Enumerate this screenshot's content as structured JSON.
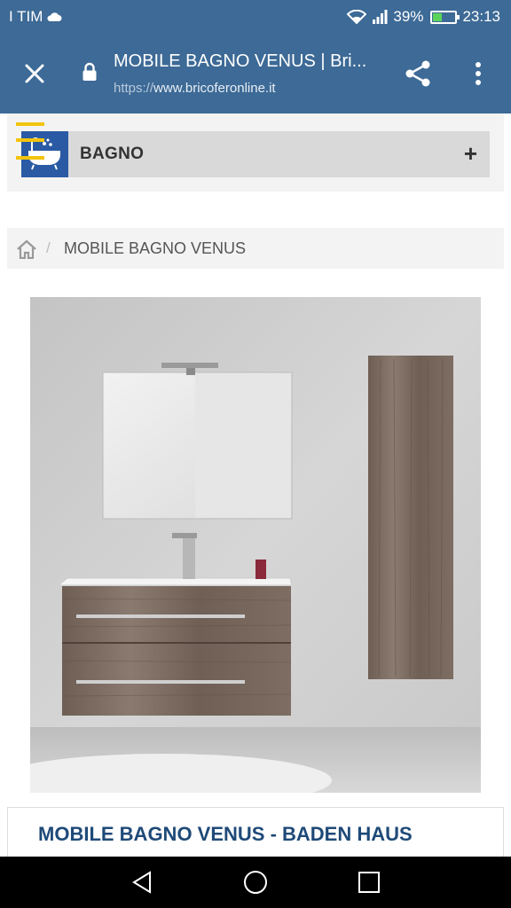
{
  "status_bar": {
    "carrier": "I TIM",
    "battery": "39%",
    "time": "23:13",
    "icons": [
      "cloud-icon",
      "wifi-icon",
      "signal-icon",
      "battery-icon"
    ]
  },
  "browser": {
    "title": "MOBILE BAGNO VENUS | Bri...",
    "url_scheme": "https://",
    "url_host": "www.bricoferonline.it",
    "icons": [
      "close-icon",
      "lock-icon",
      "share-icon",
      "more-vert-icon"
    ]
  },
  "category": {
    "label": "BAGNO",
    "expand_symbol": "+",
    "icon": "bathtub-icon",
    "accent_color": "#2b5aa5",
    "stripe_color": "#f2c40c"
  },
  "breadcrumb": {
    "separator": "/",
    "current": "MOBILE BAGNO VENUS",
    "icon": "home-icon"
  },
  "product": {
    "title": "MOBILE BAGNO VENUS - BADEN HAUS",
    "image": "bathroom-vanity-product-photo"
  },
  "nav": {
    "icons": [
      "back-icon",
      "home-circle-icon",
      "recents-icon"
    ]
  },
  "colors": {
    "header": "#3d6a96",
    "title_blue": "#1f4a78"
  }
}
